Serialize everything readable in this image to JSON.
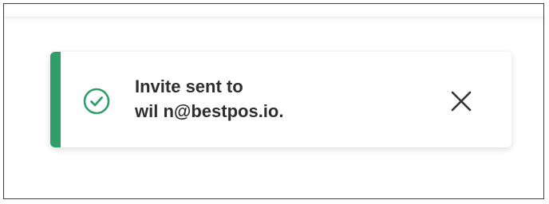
{
  "theme": {
    "accent_color": "#2f9e6b",
    "text_color": "#2e2e2e",
    "close_icon_color": "#333333"
  },
  "toast": {
    "status_icon": "check-circle-icon",
    "message_line_1": "Invite sent to",
    "message_line_2": "wil   n@bestpos.io.",
    "close_icon": "close-icon"
  }
}
